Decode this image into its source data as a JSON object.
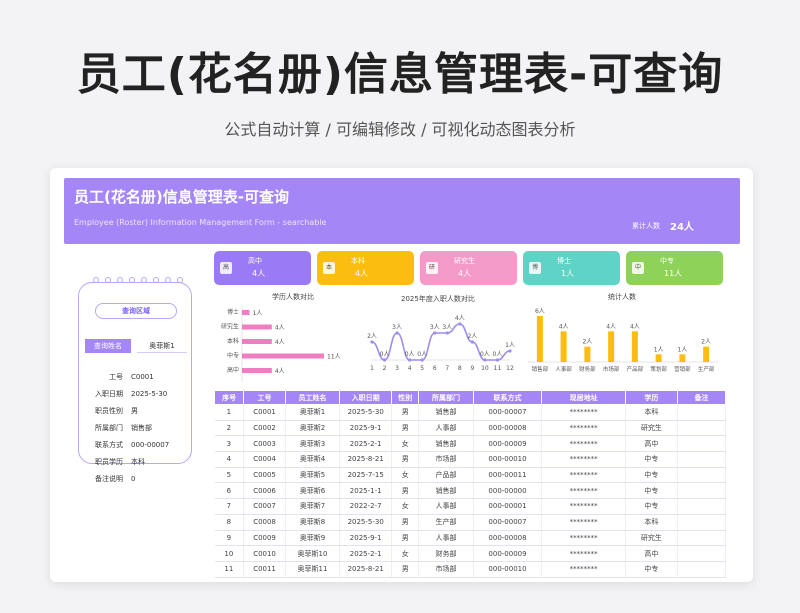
{
  "promo": {
    "title": "员工(花名册)信息管理表-可查询",
    "subtitle": "公式自动计算 /  可编辑修改  / 可视化动态图表分析"
  },
  "header": {
    "title": "员工(花名册)信息管理表-可查询",
    "subtitle": "Employee (Roster) Information Management Form - searchable",
    "total_label": "累计人数",
    "total_value": "24人"
  },
  "query": {
    "title": "查询区域",
    "name_label": "查询姓名",
    "name_value": "奥菲斯1",
    "fields": [
      {
        "key": "工号",
        "value": "C0001"
      },
      {
        "key": "入职日期",
        "value": "2025-5-30"
      },
      {
        "key": "职员性别",
        "value": "男"
      },
      {
        "key": "所属部门",
        "value": "销售部"
      },
      {
        "key": "联系方式",
        "value": "000-00007"
      },
      {
        "key": "职员学历",
        "value": "本科"
      },
      {
        "key": "备注说明",
        "value": "0"
      }
    ]
  },
  "kpis": [
    {
      "label": "高中",
      "value": "4人",
      "color": "#9b7bf5",
      "icon": "高"
    },
    {
      "label": "本科",
      "value": "4人",
      "color": "#fbbd0f",
      "icon": "本"
    },
    {
      "label": "研究生",
      "value": "4人",
      "color": "#f39ac9",
      "icon": "研"
    },
    {
      "label": "博士",
      "value": "1人",
      "color": "#5fd3c6",
      "icon": "博"
    },
    {
      "label": "中专",
      "value": "11人",
      "color": "#8fd25a",
      "icon": "中"
    }
  ],
  "chart_data": [
    {
      "type": "bar",
      "title": "学历人数对比",
      "orientation": "horizontal",
      "categories": [
        "博士",
        "研究生",
        "本科",
        "中专",
        "高中"
      ],
      "values": [
        1,
        4,
        4,
        11,
        4
      ],
      "value_labels": [
        "1人",
        "4人",
        "4人",
        "11人",
        "4人"
      ],
      "color": "#ef7ec0"
    },
    {
      "type": "line",
      "title": "2025年度入职人数对比",
      "x": [
        1,
        2,
        3,
        4,
        5,
        6,
        7,
        8,
        9,
        10,
        11,
        12
      ],
      "values": [
        2,
        0,
        3,
        0,
        0,
        3,
        3,
        4,
        2,
        0,
        0,
        1
      ],
      "value_labels": [
        "2人",
        "0人",
        "3人",
        "0人",
        "0人",
        "3人",
        "3人",
        "4人",
        "2人",
        "0人",
        "0人",
        "1人"
      ],
      "color": "#a08cf0"
    },
    {
      "type": "bar",
      "title": "统计人数",
      "categories": [
        "销售部",
        "人事部",
        "财务部",
        "市场部",
        "产品部",
        "策划部",
        "营销部",
        "生产部"
      ],
      "values": [
        6,
        4,
        2,
        4,
        4,
        1,
        1,
        2
      ],
      "value_labels": [
        "6人",
        "4人",
        "2人",
        "4人",
        "4人",
        "1人",
        "1人",
        "2人"
      ],
      "color": "#fbbd0f"
    }
  ],
  "table": {
    "columns": [
      "序号",
      "工号",
      "员工姓名",
      "入职日期",
      "性别",
      "所属部门",
      "联系方式",
      "现居地址",
      "学历",
      "备注"
    ],
    "rows": [
      [
        "1",
        "C0001",
        "奥菲斯1",
        "2025-5-30",
        "男",
        "销售部",
        "000-00007",
        "********",
        "本科",
        ""
      ],
      [
        "2",
        "C0002",
        "奥菲斯2",
        "2025-9-1",
        "男",
        "人事部",
        "000-00008",
        "********",
        "研究生",
        ""
      ],
      [
        "3",
        "C0003",
        "奥菲斯3",
        "2025-2-1",
        "女",
        "销售部",
        "000-00009",
        "********",
        "高中",
        ""
      ],
      [
        "4",
        "C0004",
        "奥菲斯4",
        "2025-8-21",
        "男",
        "市场部",
        "000-00010",
        "********",
        "中专",
        ""
      ],
      [
        "5",
        "C0005",
        "奥菲斯5",
        "2025-7-15",
        "女",
        "产品部",
        "000-00011",
        "********",
        "中专",
        ""
      ],
      [
        "6",
        "C0006",
        "奥菲斯6",
        "2025-1-1",
        "男",
        "销售部",
        "000-00000",
        "********",
        "中专",
        ""
      ],
      [
        "7",
        "C0007",
        "奥菲斯7",
        "2022-2-7",
        "女",
        "人事部",
        "000-00001",
        "********",
        "中专",
        ""
      ],
      [
        "8",
        "C0008",
        "奥菲斯8",
        "2025-5-30",
        "男",
        "生产部",
        "000-00007",
        "********",
        "本科",
        ""
      ],
      [
        "9",
        "C0009",
        "奥菲斯9",
        "2025-9-1",
        "男",
        "人事部",
        "000-00008",
        "********",
        "研究生",
        ""
      ],
      [
        "10",
        "C0010",
        "奥菲斯10",
        "2025-2-1",
        "女",
        "财务部",
        "000-00009",
        "********",
        "高中",
        ""
      ],
      [
        "11",
        "C0011",
        "奥菲斯11",
        "2025-8-21",
        "男",
        "市场部",
        "000-00010",
        "********",
        "中专",
        ""
      ]
    ]
  }
}
